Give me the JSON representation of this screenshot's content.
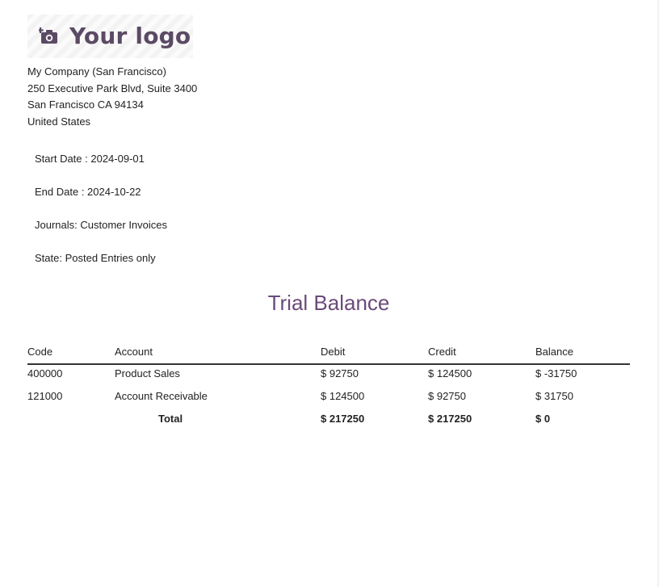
{
  "logo": {
    "text": "Your logo",
    "icon": "camera-plus-icon",
    "color": "#5b4a64"
  },
  "company": {
    "name": "My Company (San Francisco)",
    "address_line1": "250 Executive Park Blvd, Suite 3400",
    "city_line": "San Francisco CA 94134",
    "country": "United States"
  },
  "meta": {
    "start_date": "Start Date : 2024-09-01",
    "end_date": "End Date : 2024-10-22",
    "journals": "Journals: Customer Invoices",
    "state": "State: Posted Entries only"
  },
  "report": {
    "title": "Trial Balance",
    "title_color": "#6b4a7a"
  },
  "table": {
    "headers": {
      "code": "Code",
      "account": "Account",
      "debit": "Debit",
      "credit": "Credit",
      "balance": "Balance"
    },
    "rows": [
      {
        "code": "400000",
        "account": "Product Sales",
        "debit": "$ 92750",
        "credit": "$ 124500",
        "balance": "$ -31750"
      },
      {
        "code": "121000",
        "account": "Account Receivable",
        "debit": "$ 124500",
        "credit": "$ 92750",
        "balance": "$ 31750"
      }
    ],
    "total": {
      "label": "Total",
      "debit": "$ 217250",
      "credit": "$ 217250",
      "balance": "$ 0"
    }
  }
}
